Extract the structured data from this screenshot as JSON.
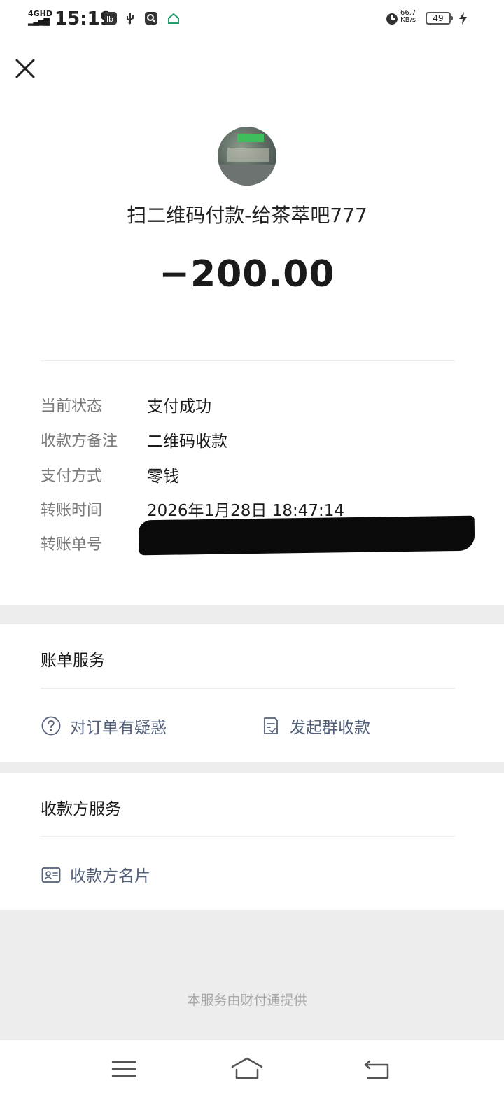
{
  "status_bar": {
    "network": "4GHD",
    "time": "15:19",
    "speed_value": "66.7",
    "speed_unit": "KB/s",
    "battery": "49"
  },
  "header": {
    "close_icon": "close-icon"
  },
  "merchant": {
    "title": "扫二维码付款-给茶萃吧777",
    "amount": "−200.00"
  },
  "details": [
    {
      "label": "当前状态",
      "value": "支付成功"
    },
    {
      "label": "收款方备注",
      "value": "二维码收款"
    },
    {
      "label": "支付方式",
      "value": "零钱"
    },
    {
      "label": "转账时间",
      "value": "2026年1月28日 18:47:14"
    },
    {
      "label": "转账单号",
      "value": ""
    }
  ],
  "bill_service": {
    "title": "账单服务",
    "question_link": "对订单有疑惑",
    "group_collect_link": "发起群收款"
  },
  "payee_service": {
    "title": "收款方服务",
    "card_link": "收款方名片"
  },
  "footer": {
    "provider_text": "本服务由财付通提供"
  },
  "colors": {
    "link": "#53607a",
    "label": "#7a7a7a",
    "band": "#ededed"
  }
}
